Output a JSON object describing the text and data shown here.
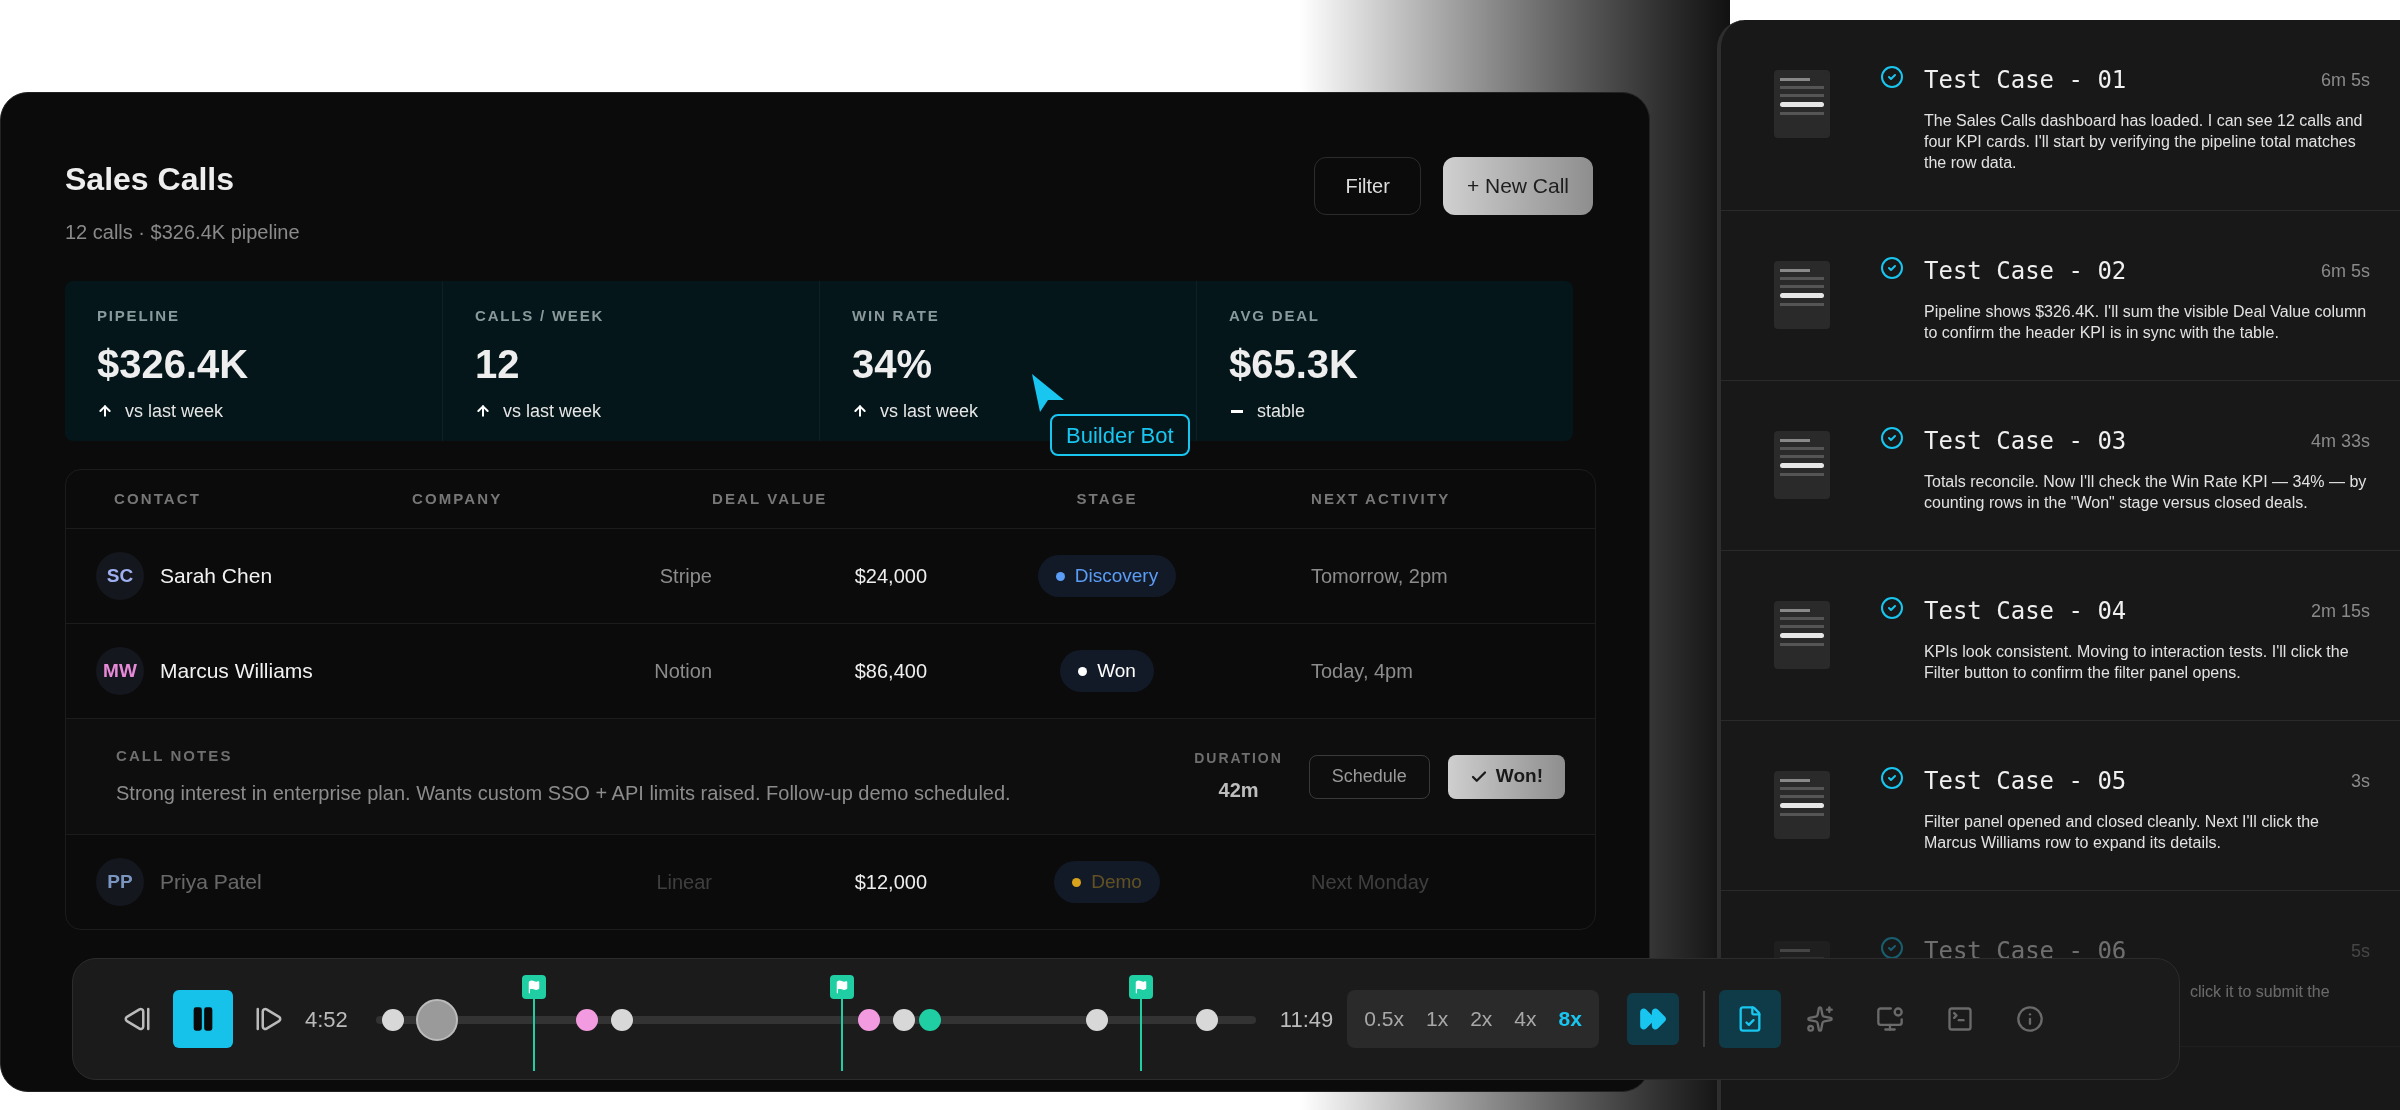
{
  "dashboard": {
    "title": "Sales Calls",
    "subtitle": "12 calls · $326.4K pipeline",
    "buttons": [
      {
        "label": "Filter",
        "kind": "outline"
      },
      {
        "label": "+ New Call",
        "kind": "primary"
      }
    ]
  },
  "kpis": [
    {
      "label": "PIPELINE",
      "value": "$326.4K",
      "kind": "up",
      "note": "vs last week"
    },
    {
      "label": "CALLS / WEEK",
      "value": "12",
      "kind": "up",
      "note": "vs last week"
    },
    {
      "label": "WIN RATE",
      "value": "34%",
      "kind": "up",
      "note": "vs last week"
    },
    {
      "label": "AVG DEAL",
      "value": "$65.3K",
      "kind": "flat",
      "note": "stable"
    }
  ],
  "cursor": {
    "label": "Builder Bot"
  },
  "table": {
    "columns": [
      "CONTACT",
      "COMPANY",
      "DEAL VALUE",
      "STAGE",
      "NEXT ACTIVITY"
    ],
    "rows": [
      {
        "avatar": {
          "initials": "SC",
          "color": "#9fb0f0"
        },
        "name": "Sarah Chen",
        "company": "Stripe",
        "deal_value": "$24,000",
        "stage": {
          "label": "Discovery",
          "color": "#5b9cf5"
        },
        "next_activity": "Tomorrow, 2pm",
        "faded": false
      },
      {
        "avatar": {
          "initials": "MW",
          "color": "#e88ad8"
        },
        "name": "Marcus Williams",
        "company": "Notion",
        "deal_value": "$86,400",
        "stage": {
          "label": "Won",
          "color": "#ffffff"
        },
        "next_activity": "Today, 4pm",
        "faded": false,
        "details": {
          "notes_label": "CALL NOTES",
          "notes": "Strong interest in enterprise plan. Wants custom SSO + API limits raised. Follow-up demo scheduled.",
          "duration_label": "DURATION",
          "duration": "42m",
          "buttons": [
            {
              "label": "Schedule",
              "kind": "outline"
            },
            {
              "label": "Won!",
              "kind": "confirm"
            }
          ]
        }
      },
      {
        "avatar": {
          "initials": "PP",
          "color": "#7a95c0"
        },
        "name": "Priya Patel",
        "company": "Linear",
        "deal_value": "$12,000",
        "stage": {
          "label": "Demo",
          "color": "#d9a21b"
        },
        "next_activity": "Next Monday",
        "faded": true
      }
    ]
  },
  "test_cases": [
    {
      "title": "Test Case - 01",
      "duration": "6m 5s",
      "description": "The Sales Calls dashboard has loaded. I can see 12 calls and four KPI cards. I'll start by verifying the pipeline total matches the row data.",
      "passed": true,
      "faded": false
    },
    {
      "title": "Test Case - 02",
      "duration": "6m 5s",
      "description": "Pipeline shows $326.4K. I'll sum the visible Deal Value column to confirm the header KPI is in sync with the table.",
      "passed": true,
      "faded": false
    },
    {
      "title": "Test Case - 03",
      "duration": "4m 33s",
      "description": "Totals reconcile. Now I'll check the Win Rate KPI — 34% — by counting rows in the \"Won\" stage versus closed deals.",
      "passed": true,
      "faded": false
    },
    {
      "title": "Test Case - 04",
      "duration": "2m 15s",
      "description": "KPIs look consistent. Moving to interaction tests. I'll click the Filter button to confirm the filter panel opens.",
      "passed": true,
      "faded": false
    },
    {
      "title": "Test Case - 05",
      "duration": "3s",
      "description": "Filter panel opened and closed cleanly. Next I'll click the Marcus Williams row to expand its details.",
      "passed": true,
      "faded": false
    },
    {
      "title": "Test Case - 06",
      "duration": "5s",
      "description": "click it to submit the",
      "passed": true,
      "faded": true
    }
  ],
  "player": {
    "current_time": "4:52",
    "total_time": "11:49",
    "level": 0.07,
    "playing": true,
    "speeds": [
      {
        "label": "0.5x",
        "selected": false
      },
      {
        "label": "1x",
        "selected": false
      },
      {
        "label": "2x",
        "selected": false
      },
      {
        "label": "4x",
        "selected": false
      },
      {
        "label": "8x",
        "selected": true
      }
    ],
    "tools": [
      {
        "kind": "steps",
        "selected": true
      },
      {
        "kind": "ai",
        "selected": false
      },
      {
        "kind": "screen",
        "selected": false
      },
      {
        "kind": "terminal",
        "selected": false
      },
      {
        "kind": "info",
        "selected": false
      }
    ]
  }
}
